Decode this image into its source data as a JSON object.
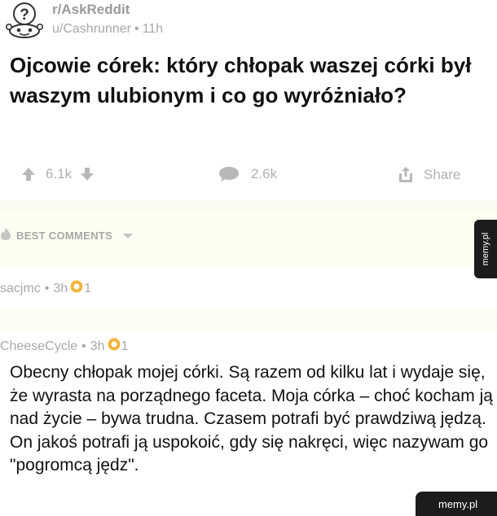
{
  "post": {
    "subreddit": "r/AskReddit",
    "author": "u/Cashrunner",
    "separator": "•",
    "age": "11h",
    "title": "Ojcowie córek: który chłopak waszej córki był waszym ulubionym i co go wyróżniało?"
  },
  "actions": {
    "votes": "6.1k",
    "comments": "2.6k",
    "share": "Share"
  },
  "sort": {
    "label": "BEST COMMENTS"
  },
  "comments": [
    {
      "author": "sacjmc",
      "separator": "•",
      "age": "3h",
      "awards": "1"
    },
    {
      "author": "CheeseCycle",
      "separator": "•",
      "age": "3h",
      "awards": "1",
      "body": "Obecny chłopak mojej córki. Są razem od kilku lat i wydaje się, że wyrasta na porządnego faceta. Moja córka – choć kocham ją nad życie – bywa trudna. Czasem potrafi być prawdziwą jędzą. On jakoś potrafi ją uspokoić, gdy się nakręci, więc nazywam go \"pogromcą jędz\"."
    }
  ],
  "watermark": {
    "side": "memy.pl",
    "corner": "memy.pl"
  },
  "icons": {
    "avatar": "snoo-question-icon",
    "upvote": "arrow-up-icon",
    "downvote": "arrow-down-icon",
    "comment": "speech-bubble-icon",
    "share": "share-icon",
    "sort": "flame-icon",
    "award": "award-icon"
  },
  "colors": {
    "muted_text": "#a8a8a8",
    "award": "#f2b33d",
    "band": "#fdfdf2"
  }
}
